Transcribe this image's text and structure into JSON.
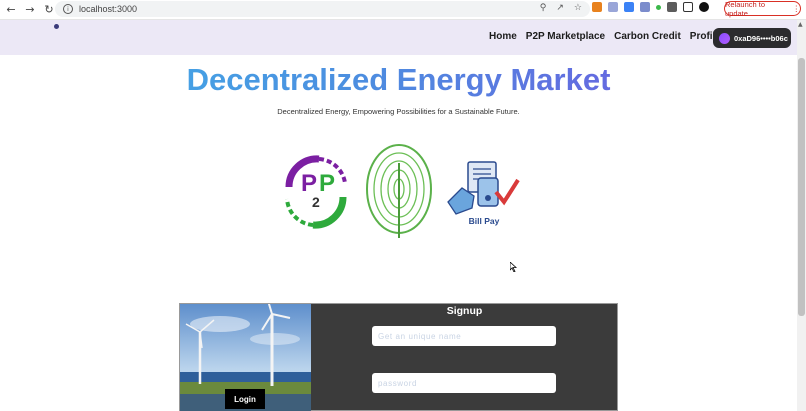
{
  "browser": {
    "url": "localhost:3000",
    "relaunch_label": "Relaunch to update"
  },
  "nav": {
    "links": [
      "Home",
      "P2P Marketplace",
      "Carbon Credit",
      "Profile"
    ],
    "wallet_address": "0xaD96••••b06c"
  },
  "hero": {
    "title": "Decentralized Energy Market",
    "subtitle": "Decentralized Energy, Empowering Possibilities for a Sustainable Future."
  },
  "features": {
    "p2p_logo_text": "P2P",
    "bill_pay_label": "Bill Pay"
  },
  "signup": {
    "title": "Signup",
    "name_placeholder": "Get an unique name",
    "password_placeholder": "password",
    "login_label": "Login"
  },
  "colors": {
    "nav_bg": "#ece8f6",
    "panel_bg": "#3b3b3b",
    "title_gradient_start": "#3fb3e8",
    "title_gradient_end": "#7650e0"
  }
}
